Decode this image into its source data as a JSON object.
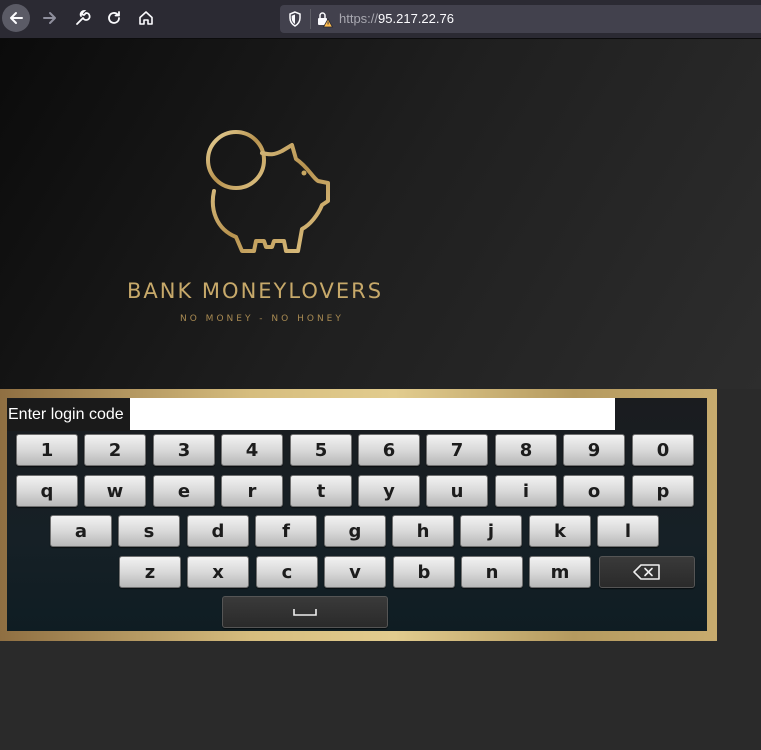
{
  "browser": {
    "url_scheme": "https://",
    "url_host": "95.217.22.76"
  },
  "brand": {
    "name": "BANK MONEYLOVERS",
    "tagline": "NO MONEY - NO HONEY",
    "accent_color": "#c7a96a"
  },
  "login": {
    "label": "Enter login code",
    "value": "",
    "placeholder": ""
  },
  "keyboard": {
    "row1": [
      "1",
      "2",
      "3",
      "4",
      "5",
      "6",
      "7",
      "8",
      "9",
      "0"
    ],
    "row2": [
      "q",
      "w",
      "e",
      "r",
      "t",
      "y",
      "u",
      "i",
      "o",
      "p"
    ],
    "row3": [
      "a",
      "s",
      "d",
      "f",
      "g",
      "h",
      "j",
      "k",
      "l"
    ],
    "row4": [
      "z",
      "x",
      "c",
      "v",
      "b",
      "n",
      "m"
    ],
    "backspace_icon": "backspace-icon",
    "space_icon": "space-bar-icon"
  }
}
